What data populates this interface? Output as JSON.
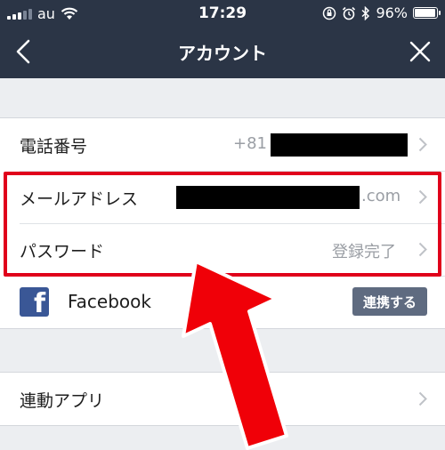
{
  "status_bar": {
    "carrier": "au",
    "time": "17:29",
    "battery": "96%",
    "battery_level": 0.96
  },
  "nav": {
    "title": "アカウント"
  },
  "rows": {
    "phone": {
      "label": "電話番号",
      "value": "+81"
    },
    "email": {
      "label": "メールアドレス",
      "value": ".com"
    },
    "password": {
      "label": "パスワード",
      "value": "登録完了"
    },
    "facebook": {
      "label": "Facebook",
      "button": "連携する"
    },
    "linked_apps": {
      "label": "連動アプリ"
    }
  },
  "colors": {
    "nav_bg": "#2b3546",
    "highlight": "#e0001b",
    "arrow": "#f00008",
    "facebook": "#3a5796",
    "button": "#5f6b80"
  }
}
